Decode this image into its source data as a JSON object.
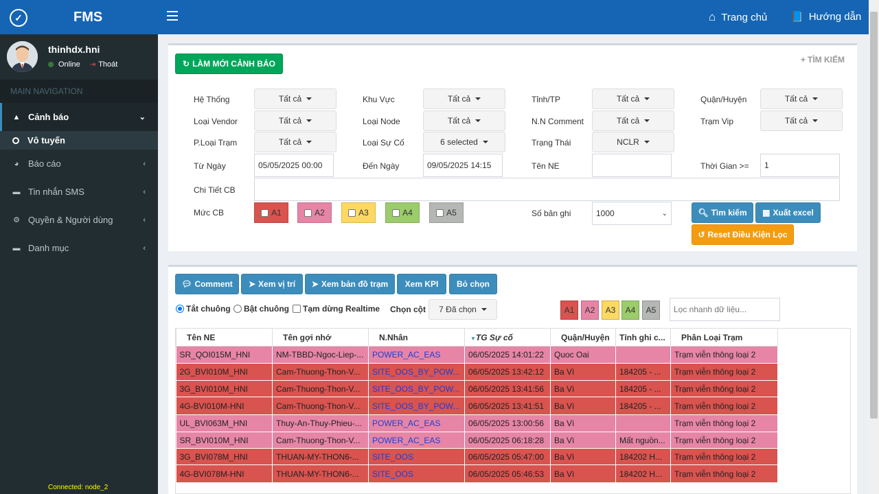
{
  "app": {
    "title": "FMS",
    "brand_color": "#1565b4"
  },
  "user": {
    "name": "thinhdx.hni",
    "status": "Online",
    "logout": "Thoát"
  },
  "sidebar": {
    "heading": "MAIN NAVIGATION",
    "items": [
      {
        "label": "Cảnh báo",
        "icon": "warning-icon"
      },
      {
        "label": "Vô tuyến",
        "icon": "circle-icon"
      },
      {
        "label": "Báo cáo",
        "icon": "pie-chart-icon"
      },
      {
        "label": "Tin nhắn SMS",
        "icon": "folder-icon"
      },
      {
        "label": "Quyền & Người dùng",
        "icon": "gears-icon"
      },
      {
        "label": "Danh mục",
        "icon": "folder-icon"
      }
    ],
    "connected": "Connected: node_2"
  },
  "topbar": {
    "home": "Trang chủ",
    "guide": "Hướng dẫn"
  },
  "filters": {
    "refresh_button": "LÀM MỚI CẢNH BÁO",
    "search_toggle": "TÌM KIẾM",
    "he_thong": {
      "label": "Hệ Thống",
      "value": "Tất cả"
    },
    "khu_vuc": {
      "label": "Khu Vực",
      "value": "Tất cả"
    },
    "tinh_tp": {
      "label": "Tỉnh/TP",
      "value": "Tất cả"
    },
    "quan_huyen": {
      "label": "Quận/Huyện",
      "value": "Tất cả"
    },
    "loai_vendor": {
      "label": "Loại Vendor",
      "value": "Tất cả"
    },
    "loai_node": {
      "label": "Loại Node",
      "value": "Tất cả"
    },
    "nn_comment": {
      "label": "N.N Comment",
      "value": "Tất cả"
    },
    "tram_vip": {
      "label": "Trạm Vip",
      "value": "Tất cả"
    },
    "ploai_tram": {
      "label": "P.Loại Trạm",
      "value": "Tất cả"
    },
    "loai_su_co": {
      "label": "Loại Sự Cố",
      "value": "6 selected"
    },
    "trang_thai": {
      "label": "Trạng Thái",
      "value": "NCLR"
    },
    "tu_ngay": {
      "label": "Từ Ngày",
      "value": "05/05/2025 00:00"
    },
    "den_ngay": {
      "label": "Đến Ngày",
      "value": "09/05/2025 14:15"
    },
    "ten_ne": {
      "label": "Tên NE",
      "value": ""
    },
    "thoi_gian": {
      "label": "Thời Gian >=",
      "value": "1"
    },
    "chi_tiet_cb": {
      "label": "Chi Tiết CB",
      "value": ""
    },
    "muc_cb": {
      "label": "Mức CB",
      "levels": [
        "A1",
        "A2",
        "A3",
        "A4",
        "A5"
      ]
    },
    "so_ban_ghi": {
      "label": "Số bản ghi",
      "value": "1000"
    },
    "search_button": "Tìm kiếm",
    "export_button": "Xuất excel",
    "reset_button": "Reset Điều Kiện Lọc"
  },
  "toolbar": {
    "comment": "Comment",
    "xem_vi_tri": "Xem vị trí",
    "xem_ban_do": "Xem bản đồ trạm",
    "xem_kpi": "Xem KPI",
    "bo_chon": "Bỏ chọn",
    "tat_chuong": "Tắt chuông",
    "bat_chuong": "Bật chuông",
    "tam_dung": "Tạm dừng Realtime",
    "chon_cot_label": "Chọn cột",
    "chon_cot_value": "7 Đã chọn",
    "quick_filter_placeholder": "Lọc nhanh dữ liệu..."
  },
  "level_colors": {
    "A1": "#d9534f",
    "A2": "#e685a6",
    "A3": "#fdd964",
    "A4": "#9ccc6b",
    "A5": "#b5b7b4"
  },
  "table": {
    "headers": [
      "Tên NE",
      "Tên gợi nhớ",
      "N.Nhân",
      "TG Sự cố",
      "Quận/Huyện",
      "Tỉnh ghi c...",
      "Phân Loại Trạm"
    ],
    "rows": [
      {
        "level": "A2",
        "cells": [
          "SR_QOI015M_HNI",
          "NM-TBBD-Ngoc-Liep-...",
          "POWER_AC_EAS",
          "06/05/2025 14:01:22",
          "Quoc Oai",
          "",
          "Trạm viễn thông loại 2"
        ]
      },
      {
        "level": "A1",
        "cells": [
          "2G_BVI010M_HNI",
          "Cam-Thuong-Thon-V...",
          "SITE_OOS_BY_POW...",
          "06/05/2025 13:42:12",
          "Ba Vì",
          "184205 - ...",
          "Trạm viễn thông loại 2"
        ]
      },
      {
        "level": "A1",
        "cells": [
          "3G_BVI010M_HNI",
          "Cam-Thuong-Thon-V...",
          "SITE_OOS_BY_POW...",
          "06/05/2025 13:41:56",
          "Ba Vì",
          "184205 - ...",
          "Trạm viễn thông loại 2"
        ]
      },
      {
        "level": "A1",
        "cells": [
          "4G-BVI010M-HNI",
          "Cam-Thuong-Thon-V...",
          "SITE_OOS_BY_POW...",
          "06/05/2025 13:41:51",
          "Ba Vì",
          "184205 - ...",
          "Trạm viễn thông loại 2"
        ]
      },
      {
        "level": "A2",
        "cells": [
          "UL_BVI063M_HNI",
          "Thuy-An-Thuy-Phieu-...",
          "POWER_AC_EAS",
          "06/05/2025 13:00:56",
          "Ba Vì",
          "",
          "Trạm viễn thông loại 2"
        ]
      },
      {
        "level": "A2",
        "cells": [
          "SR_BVI010M_HNI",
          "Cam-Thuong-Thon-V...",
          "POWER_AC_EAS",
          "06/05/2025 06:18:28",
          "Ba Vì",
          "Mất nguồn...",
          "Trạm viễn thông loại 2"
        ]
      },
      {
        "level": "A1",
        "cells": [
          "3G_BVI078M_HNI",
          "THUAN-MY-THON6-...",
          "SITE_OOS",
          "06/05/2025 05:47:00",
          "Ba Vì",
          "184202 H...",
          "Trạm viễn thông loại 2"
        ]
      },
      {
        "level": "A1",
        "cells": [
          "4G-BVI078M-HNI",
          "THUAN-MY-THON6-...",
          "SITE_OOS",
          "06/05/2025 05:46:53",
          "Ba Vì",
          "184202 H...",
          "Trạm viễn thông loại 2"
        ]
      }
    ]
  }
}
